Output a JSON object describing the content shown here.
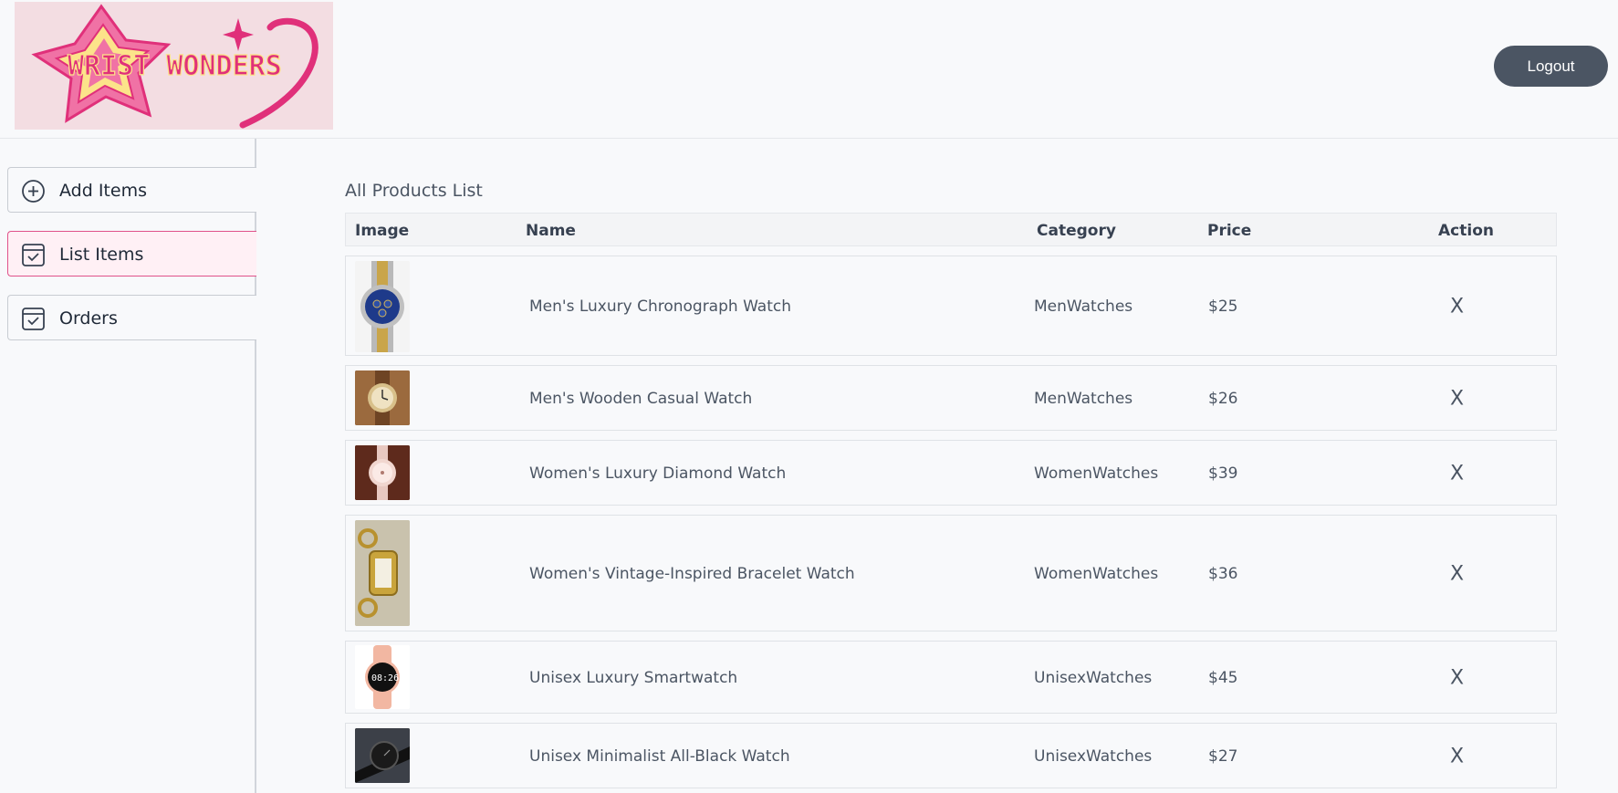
{
  "header": {
    "logo_text": "WRIST WONDERS",
    "logout_label": "Logout"
  },
  "sidebar": {
    "items": [
      {
        "label": "Add Items",
        "icon": "plus-circle-icon",
        "active": false
      },
      {
        "label": "List Items",
        "icon": "checklist-icon",
        "active": true
      },
      {
        "label": "Orders",
        "icon": "checklist-icon",
        "active": false
      }
    ]
  },
  "main": {
    "title": "All Products List",
    "columns": [
      "Image",
      "Name",
      "Category",
      "Price",
      "Action"
    ],
    "products": [
      {
        "name": "Men's Luxury Chronograph Watch",
        "category": "MenWatches",
        "price": "$25",
        "action": "X"
      },
      {
        "name": "Men's Wooden Casual Watch",
        "category": "MenWatches",
        "price": "$26",
        "action": "X"
      },
      {
        "name": "Women's Luxury Diamond Watch",
        "category": "WomenWatches",
        "price": "$39",
        "action": "X"
      },
      {
        "name": "Women's Vintage-Inspired Bracelet Watch",
        "category": "WomenWatches",
        "price": "$36",
        "action": "X"
      },
      {
        "name": "Unisex Luxury Smartwatch",
        "category": "UnisexWatches",
        "price": "$45",
        "action": "X"
      },
      {
        "name": "Unisex Minimalist All-Black Watch",
        "category": "UnisexWatches",
        "price": "$27",
        "action": "X"
      }
    ]
  },
  "colors": {
    "accent": "#e0528a",
    "logout_bg": "#4b5563",
    "active_nav_bg": "#fff0f5"
  }
}
